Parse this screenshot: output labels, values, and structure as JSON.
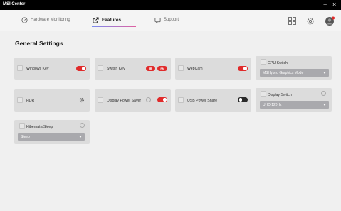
{
  "window": {
    "title": "MSI Center",
    "minimize_label": "−",
    "close_label": "×"
  },
  "tabs": [
    {
      "label": "Hardware Monitoring",
      "icon": "gauge-icon",
      "active": false
    },
    {
      "label": "Features",
      "icon": "external-link-icon",
      "active": true
    },
    {
      "label": "Support",
      "icon": "chat-icon",
      "active": false
    }
  ],
  "nav_icons": [
    "grid-icon",
    "gear-icon",
    "user-avatar-icon"
  ],
  "section_title": "General Settings",
  "cards": {
    "windows_key": {
      "label": "Windows Key",
      "toggle": "on"
    },
    "switch_key": {
      "label": "Switch Key",
      "pill_left": "⊞",
      "pill_right": "FN"
    },
    "webcam": {
      "label": "WebCam",
      "toggle": "on"
    },
    "gpu_switch": {
      "label": "GPU Switch",
      "selected": "MSHybrid Graphics Mode"
    },
    "hdr": {
      "label": "HDR",
      "icon": "gear-icon"
    },
    "display_power_saver": {
      "label": "Display Power Saver",
      "toggle": "on",
      "info_icon": "info-icon"
    },
    "usb_power_share": {
      "label": "USB Power Share",
      "toggle": "off"
    },
    "display_switch": {
      "label": "Display Switch",
      "selected": "UHD 120Hz",
      "info_icon": "info-icon"
    },
    "hibernate_sleep": {
      "label": "Hibernate/Sleep",
      "selected": "Sleep",
      "info_icon": "info-icon"
    }
  },
  "colors": {
    "accent": "#e02a2a",
    "toggle_off": "#2a2a2a",
    "card_bg": "#dcdcdc",
    "select_bg": "#a9a9ad"
  }
}
